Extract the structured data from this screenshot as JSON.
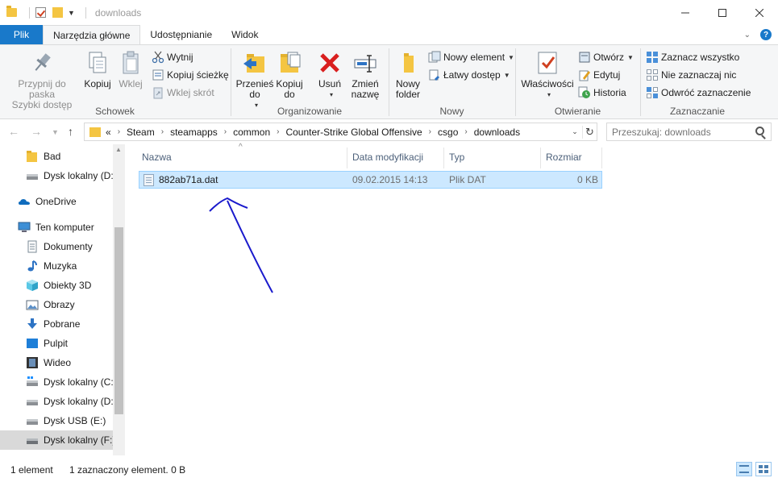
{
  "window": {
    "title": "downloads",
    "controls": [
      "minimize",
      "maximize",
      "close"
    ]
  },
  "tabs": [
    {
      "label": "Plik"
    },
    {
      "label": "Narzędzia główne"
    },
    {
      "label": "Udostępnianie"
    },
    {
      "label": "Widok"
    }
  ],
  "ribbon": {
    "schowek": {
      "pin": "Przypnij do paska\nSzybki dostęp",
      "pin_line1": "Przypnij do paska",
      "pin_line2": "Szybki dostęp",
      "copy": "Kopiuj",
      "paste": "Wklej",
      "cut": "Wytnij",
      "copy_path": "Kopiuj ścieżkę",
      "paste_shortcut": "Wklej skrót",
      "group_label": "Schowek"
    },
    "organizowanie": {
      "move_line1": "Przenieś",
      "move_line2": "do",
      "copy_line1": "Kopiuj",
      "copy_line2": "do",
      "delete": "Usuń",
      "rename_line1": "Zmień",
      "rename_line2": "nazwę",
      "group_label": "Organizowanie"
    },
    "nowy": {
      "new_folder_line1": "Nowy",
      "new_folder_line2": "folder",
      "new_item": "Nowy element",
      "easy_access": "Łatwy dostęp",
      "group_label": "Nowy"
    },
    "otwieranie": {
      "properties": "Właściwości",
      "open": "Otwórz",
      "edit": "Edytuj",
      "history": "Historia",
      "group_label": "Otwieranie"
    },
    "zaznaczanie": {
      "select_all": "Zaznacz wszystko",
      "select_none": "Nie zaznaczaj nic",
      "invert": "Odwróć zaznaczenie",
      "group_label": "Zaznaczanie"
    }
  },
  "address": {
    "prefix": "«",
    "crumbs": [
      "Steam",
      "steamapps",
      "common",
      "Counter-Strike Global Offensive",
      "csgo",
      "downloads"
    ]
  },
  "search": {
    "placeholder": "Przeszukaj: downloads"
  },
  "sidebar": {
    "items": [
      {
        "label": "Bad",
        "icon": "folder-icon"
      },
      {
        "label": "Dysk lokalny (D:)",
        "icon": "drive-icon"
      },
      {
        "label": "OneDrive",
        "icon": "onedrive-icon"
      },
      {
        "label": "Ten komputer",
        "icon": "computer-icon"
      },
      {
        "label": "Dokumenty",
        "icon": "documents-icon"
      },
      {
        "label": "Muzyka",
        "icon": "music-icon"
      },
      {
        "label": "Obiekty 3D",
        "icon": "3d-objects-icon"
      },
      {
        "label": "Obrazy",
        "icon": "pictures-icon"
      },
      {
        "label": "Pobrane",
        "icon": "downloads-icon"
      },
      {
        "label": "Pulpit",
        "icon": "desktop-icon"
      },
      {
        "label": "Wideo",
        "icon": "video-icon"
      },
      {
        "label": "Dysk lokalny (C:)",
        "icon": "drive-icon"
      },
      {
        "label": "Dysk lokalny (D:)",
        "icon": "drive-icon"
      },
      {
        "label": "Dysk USB (E:)",
        "icon": "usb-drive-icon"
      },
      {
        "label": "Dysk lokalny (F:)",
        "icon": "drive-icon",
        "selected": true
      }
    ]
  },
  "columns": {
    "name": "Nazwa",
    "modified": "Data modyfikacji",
    "type": "Typ",
    "size": "Rozmiar"
  },
  "files": [
    {
      "name": "882ab71a.dat",
      "modified": "09.02.2015 14:13",
      "type": "Plik DAT",
      "size": "0 KB",
      "selected": true
    }
  ],
  "status": {
    "count": "1 element",
    "selection": "1 zaznaczony element. 0 B"
  },
  "colors": {
    "file_tab": "#1979ca",
    "selection": "#cce8ff",
    "selection_border": "#99d1ff",
    "annotation_arrow": "#1a1acc",
    "folder": "#f4c542"
  }
}
